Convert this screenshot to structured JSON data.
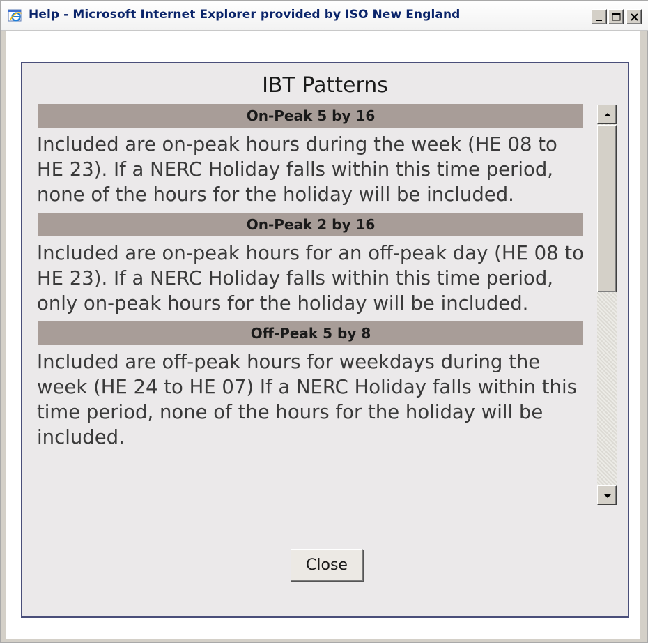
{
  "window": {
    "title": "Help - Microsoft Internet Explorer provided by ISO New England",
    "title_color": "#0a246a",
    "icon": "ie-icon"
  },
  "controls": {
    "minimize": "minimize-icon",
    "maximize": "maximize-icon",
    "close": "close-icon"
  },
  "panel": {
    "title": "IBT Patterns",
    "border_color": "#4a4f7a",
    "header_color": "#a89d98",
    "sections": [
      {
        "header": "On-Peak 5 by 16",
        "body": "Included are on-peak hours during the week (HE 08 to HE 23). If a NERC Holiday falls within this time period, none of the hours for the holiday will be included."
      },
      {
        "header": "On-Peak 2 by 16",
        "body": "Included are on-peak hours for an off-peak day (HE 08 to HE 23). If a NERC Holiday falls within this time period, only on-peak hours for the holiday will be included."
      },
      {
        "header": "Off-Peak 5 by 8",
        "body": "Included are off-peak hours for weekdays during the week (HE 24 to HE 07) If a NERC Holiday falls within this time period, none of the hours for the holiday will be included."
      }
    ]
  },
  "buttons": {
    "close_label": "Close"
  },
  "scrollbar": {
    "up": "scroll-up-arrow-icon",
    "down": "scroll-down-arrow-icon"
  }
}
